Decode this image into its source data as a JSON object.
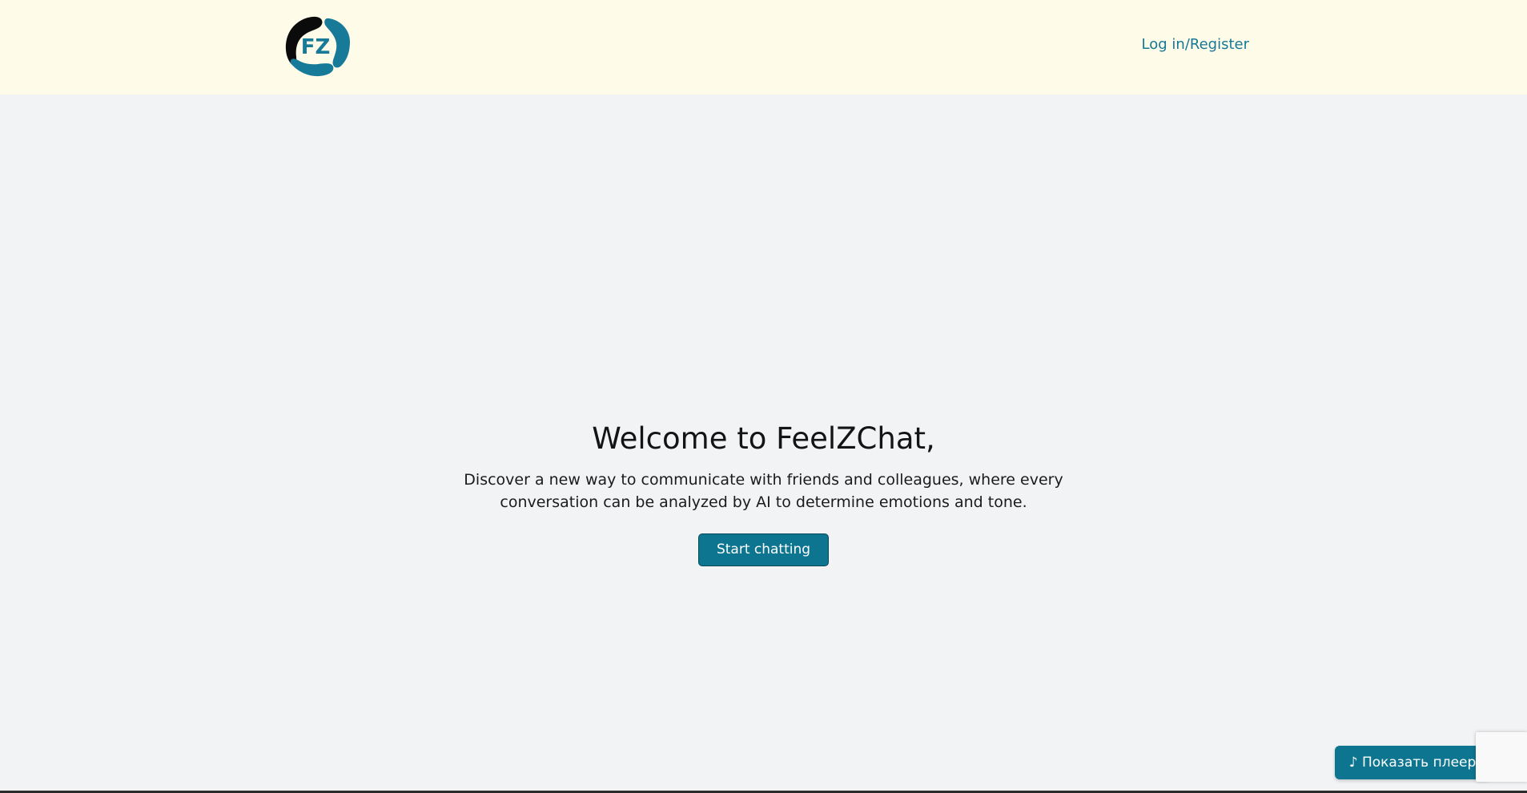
{
  "header": {
    "logo_text": "FZ",
    "login_label": "Log in/Register"
  },
  "hero": {
    "title": "Welcome to FeelZChat,",
    "description": "Discover a new way to communicate with friends and colleagues, where every conversation can be analyzed by AI to determine emotions and tone.",
    "cta_label": "Start chatting"
  },
  "player": {
    "toggle_label": "♪ Показать плеер"
  },
  "colors": {
    "header_bg": "#fefbe8",
    "page_bg": "#f2f3f5",
    "accent": "#0d7590",
    "link": "#167896"
  },
  "icons": {
    "logo": "feelzchat-logo-icon"
  }
}
